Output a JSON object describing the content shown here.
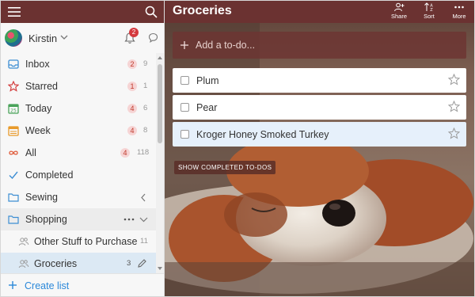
{
  "user": {
    "name": "Kirstin",
    "notification_count": "2"
  },
  "sidebar": {
    "items": [
      {
        "label": "Inbox",
        "overdue": "2",
        "count": "9"
      },
      {
        "label": "Starred",
        "overdue": "1",
        "count": "1"
      },
      {
        "label": "Today",
        "overdue": "4",
        "count": "6"
      },
      {
        "label": "Week",
        "overdue": "4",
        "count": "8"
      },
      {
        "label": "All",
        "overdue": "4",
        "count": "118"
      },
      {
        "label": "Completed"
      },
      {
        "label": "Sewing"
      },
      {
        "label": "Shopping"
      },
      {
        "label": "Other Stuff to Purchase",
        "count": "11"
      },
      {
        "label": "Groceries",
        "count": "3"
      }
    ],
    "create_list_label": "Create list"
  },
  "main": {
    "title": "Groceries",
    "header_buttons": [
      {
        "label": "Share",
        "icon": "share-icon"
      },
      {
        "label": "Sort",
        "icon": "sort-icon"
      },
      {
        "label": "More",
        "icon": "more-icon"
      }
    ],
    "add_placeholder": "Add a to-do...",
    "tasks": [
      {
        "title": "Plum"
      },
      {
        "title": "Pear"
      },
      {
        "title": "Kroger Honey Smoked Turkey"
      }
    ],
    "show_completed_label": "SHOW COMPLETED TO-DOS"
  },
  "colors": {
    "header": "#6b3231",
    "accent": "#2b88d9",
    "badge": "#d4393e",
    "active_row": "#dce9f4"
  }
}
